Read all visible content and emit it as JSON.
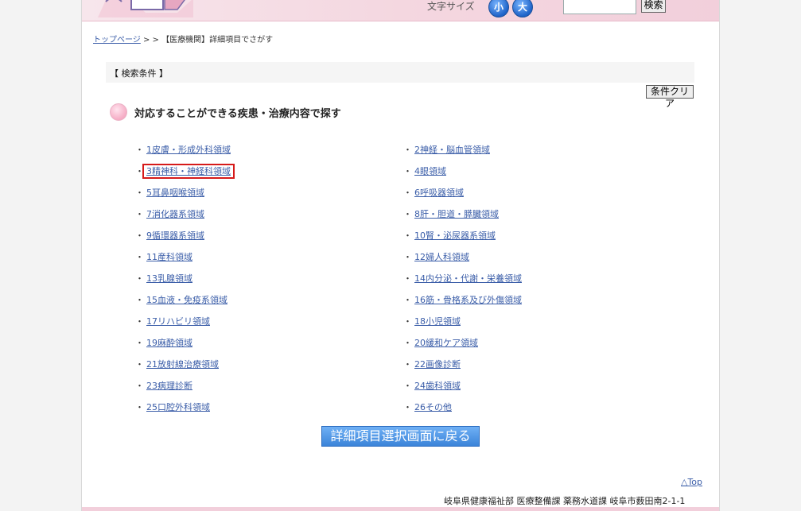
{
  "header": {
    "fontsize_label": "文字サイズ",
    "small_label": "小",
    "large_label": "大",
    "search_value": "",
    "search_button": "検索"
  },
  "breadcrumb": {
    "top_link": "トップページ",
    "separator": " > > ",
    "current": "【医療機関】詳細項目でさがす"
  },
  "conditions": {
    "label": "【 検索条件 】",
    "clear_button": "条件クリア"
  },
  "section": {
    "heading": "対応することができる疾患・治療内容で探す"
  },
  "items_left": [
    {
      "label": "1皮膚・形成外科領域"
    },
    {
      "label": "3精神科・神経科領域"
    },
    {
      "label": "5耳鼻咽喉領域"
    },
    {
      "label": "7消化器系領域"
    },
    {
      "label": "9循環器系領域"
    },
    {
      "label": "11産科領域"
    },
    {
      "label": "13乳腺領域"
    },
    {
      "label": "15血液・免疫系領域"
    },
    {
      "label": "17リハビリ領域"
    },
    {
      "label": "19麻酔領域"
    },
    {
      "label": "21放射線治療領域"
    },
    {
      "label": "23病理診断"
    },
    {
      "label": "25口腔外科領域"
    }
  ],
  "items_right": [
    {
      "label": "2神経・脳血管領域"
    },
    {
      "label": "4眼領域"
    },
    {
      "label": "6呼吸器領域"
    },
    {
      "label": "8肝・胆道・膵臓領域"
    },
    {
      "label": "10腎・泌尿器系領域"
    },
    {
      "label": "12婦人科領域"
    },
    {
      "label": "14内分泌・代謝・栄養領域"
    },
    {
      "label": "16筋・骨格系及び外傷領域"
    },
    {
      "label": "18小児領域"
    },
    {
      "label": "20緩和ケア領域"
    },
    {
      "label": "22画像診断"
    },
    {
      "label": "24歯科領域"
    },
    {
      "label": "26その他"
    }
  ],
  "bullet": "・",
  "back_button": "詳細項目選択画面に戻る",
  "top_link": "△Top",
  "footer": "岐阜県健康福祉部 医療整備課 薬務水道課 岐阜市薮田南2-1-1"
}
